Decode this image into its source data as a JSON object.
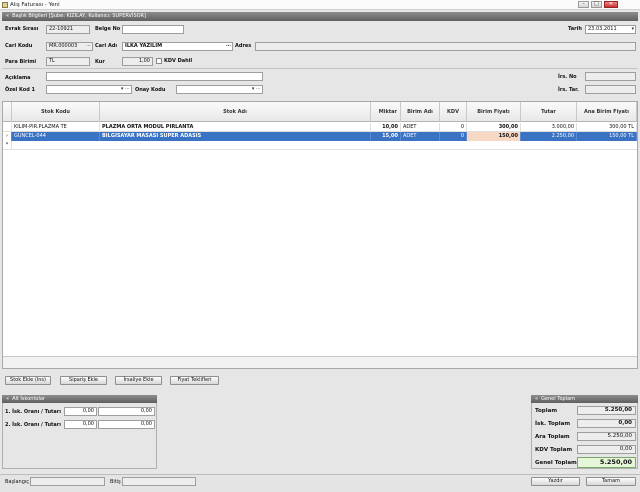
{
  "window": {
    "title": "Alış Faturası - Yeni"
  },
  "header_section": {
    "title": "Başlık Bilgileri [Şube: KIZILAY, Kullanıcı: SUPERVİSOR]"
  },
  "form": {
    "evrak_sirasi_label": "Evrak Sırası",
    "evrak_sirasi": "22-10921",
    "belge_no_label": "Belge No",
    "belge_no": "",
    "tarih_label": "Tarih",
    "tarih": "23.03.2011",
    "cari_kodu_label": "Cari Kodu",
    "cari_kodu": "MR.000003",
    "cari_adi_label": "Cari Adı",
    "cari_adi": "İLKA YAZILIM",
    "adres_label": "Adres",
    "adres": "",
    "para_birimi_label": "Para Birimi",
    "para_birimi": "TL",
    "kur_label": "Kur",
    "kur": "1,00",
    "kdv_dahil_label": "KDV Dahil",
    "aciklama_label": "Açıklama",
    "aciklama": "",
    "ozel_kod_label": "Özel Kod 1",
    "ozel_kod": "",
    "onay_kodu_label": "Onay Kodu",
    "onay_kodu": "",
    "irs_no_label": "İrs. No",
    "irs_no": "",
    "irs_tar_label": "İrs. Tar.",
    "irs_tar": ""
  },
  "grid": {
    "columns": [
      "Stok Kodu",
      "Stok Adı",
      "Miktar",
      "Birim Adı",
      "KDV",
      "Birim Fiyatı",
      "Tutar",
      "Ana Birim Fiyatı"
    ],
    "rows": [
      {
        "stok_kodu": "KILIM-PIR.PLAZMA TE",
        "stok_adi": "PLAZMA ORTA MODUL PIRLANTA",
        "miktar": "10,00",
        "birim": "ADET",
        "kdv": "0",
        "birim_fiyati": "300,00",
        "tutar": "3.000,00",
        "ana_birim_fiyati": "300,00 TL"
      },
      {
        "stok_kodu": "GUNCEL-044",
        "stok_adi": "BILGISAYAR MASASI SUPER ADASIS",
        "miktar": "15,00",
        "birim": "ADET",
        "kdv": "0",
        "birim_fiyati": "150,00",
        "tutar": "2.250,00",
        "ana_birim_fiyati": "150,00 TL"
      }
    ],
    "new_row_marker": "*",
    "current_row_marker": "›"
  },
  "actions": {
    "stok_ekle": "Stok Ekle (Ins)",
    "siparis_ekle": "Sipariş Ekle",
    "irsaliye_ekle": "İrsaliye Ekle",
    "fiyat_teklifleri": "Fiyat Teklifleri"
  },
  "discounts": {
    "title": "Alt İskontolar",
    "row1_label": "1. İsk. Oranı / Tutarı",
    "row1_rate": "0,00",
    "row1_amount": "0,00",
    "row2_label": "2. İsk. Oranı / Tutarı",
    "row2_rate": "0,00",
    "row2_amount": "0,00"
  },
  "totals": {
    "title": "Genel Toplam",
    "toplam_label": "Toplam",
    "toplam": "5.250,00",
    "isk_label": "İsk. Toplam",
    "isk": "0,00",
    "ara_label": "Ara Toplam",
    "ara": "5.250,00",
    "kdv_label": "KDV Toplam",
    "kdv": "0,00",
    "genel_label": "Genel Toplam",
    "genel": "5.250,00"
  },
  "status": {
    "baslangic_label": "Başlangıç",
    "baslangic": "",
    "bitis_label": "Bitiş",
    "bitis": "",
    "yazdir": "Yazdır",
    "tamam": "Tamam"
  }
}
